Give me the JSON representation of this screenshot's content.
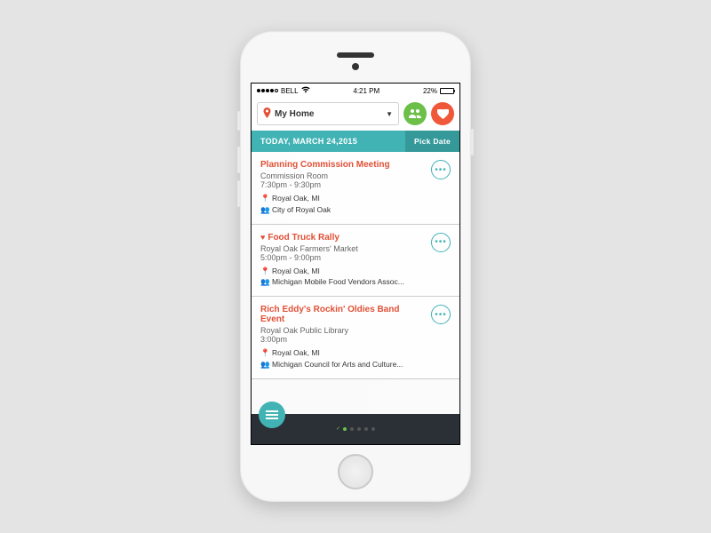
{
  "status": {
    "carrier": "BELL",
    "time": "4:21 PM",
    "battery_pct": "22%"
  },
  "location_picker": {
    "label": "My Home"
  },
  "date_bar": {
    "label": "TODAY, MARCH 24,2015",
    "pick_date": "Pick Date"
  },
  "events": [
    {
      "title": "Planning Commission Meeting",
      "favorited": false,
      "venue": "Commission Room",
      "time": "7:30pm - 9:30pm",
      "location": "Royal Oak, MI",
      "org": "City of Royal Oak"
    },
    {
      "title": "Food Truck Rally",
      "favorited": true,
      "venue": "Royal Oak Farmers' Market",
      "time": "5:00pm - 9:00pm",
      "location": "Royal Oak, MI",
      "org": "Michigan Mobile Food Vendors Assoc..."
    },
    {
      "title": "Rich Eddy's Rockin' Oldies Band Event",
      "favorited": false,
      "venue": "Royal Oak Public Library",
      "time": "3:00pm",
      "location": "Royal Oak, MI",
      "org": "Michigan Council for Arts and Culture..."
    }
  ],
  "colors": {
    "teal": "#42b3b5",
    "teal_dark": "#35999a",
    "green": "#6cc04a",
    "red": "#ef5839",
    "accent_text": "#e25036"
  },
  "pager": {
    "count": 6,
    "active_index": 1
  }
}
